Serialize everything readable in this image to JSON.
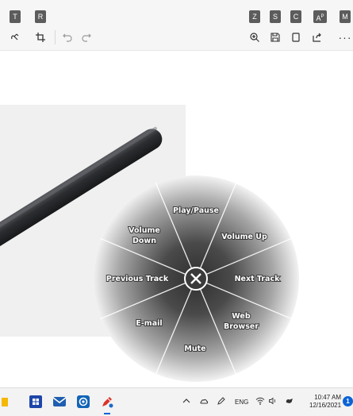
{
  "toolbar": {
    "keytips": {
      "touch_writing": "T",
      "crop": "R",
      "zoom": "Z",
      "save": "S",
      "copy": "C",
      "share": "A",
      "share_sub": "P",
      "more": "M"
    }
  },
  "radial_menu": {
    "items": [
      "Play/Pause",
      "Volume Up",
      "Next Track",
      "Web Browser",
      "Mute",
      "E-mail",
      "Previous Track",
      "Volume Down"
    ],
    "labels": {
      "play_pause": "Play/Pause",
      "volume_up": "Volume Up",
      "next_track": "Next Track",
      "web_1": "Web",
      "web_2": "Browser",
      "mute": "Mute",
      "email": "E-mail",
      "previous_track": "Previous Track",
      "volume_down_1": "Volume",
      "volume_down_2": "Down"
    },
    "center_icon": "close-icon"
  },
  "taskbar": {
    "apps": [
      "file-explorer-icon",
      "start-icon",
      "mail-icon",
      "dell-app-icon",
      "pen-settings-icon"
    ],
    "tray": {
      "language": "ENG",
      "time": "10:47 AM",
      "date": "12/16/2021",
      "notifications": "1"
    }
  },
  "colors": {
    "accent": "#0a63d6",
    "taskbar_bg": "#f3f3f3",
    "toolbar_bg": "#f6f6f6"
  }
}
